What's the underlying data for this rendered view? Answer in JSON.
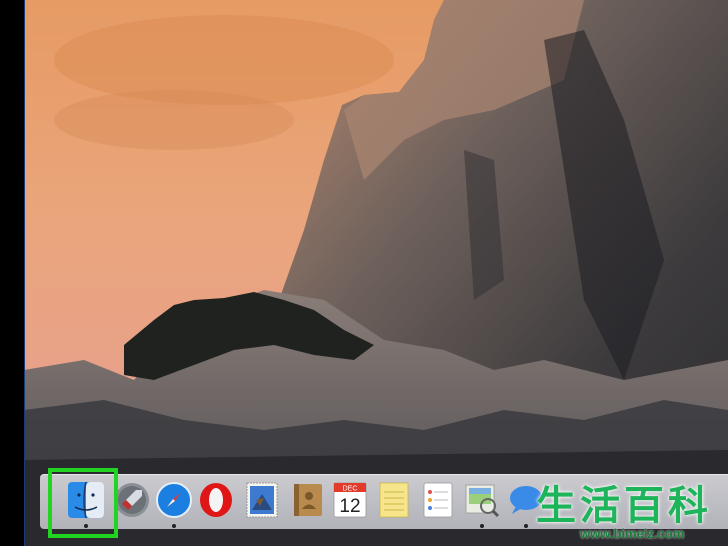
{
  "desktop": {
    "wallpaper_name": "Yosemite",
    "edge_color": "#1a3a7a"
  },
  "dock": {
    "items": [
      {
        "name": "Finder",
        "icon": "finder-icon",
        "running": true
      },
      {
        "name": "Launchpad",
        "icon": "rocket-icon",
        "running": false
      },
      {
        "name": "Safari",
        "icon": "compass-icon",
        "running": true
      },
      {
        "name": "Opera",
        "icon": "opera-icon",
        "running": false
      },
      {
        "name": "Mail",
        "icon": "stamp-icon",
        "running": false
      },
      {
        "name": "Contacts",
        "icon": "address-book-icon",
        "running": false
      },
      {
        "name": "Calendar",
        "icon": "calendar-icon",
        "running": false,
        "month": "DEC",
        "day": "12"
      },
      {
        "name": "Notes",
        "icon": "notes-icon",
        "running": false
      },
      {
        "name": "Reminders",
        "icon": "reminders-icon",
        "running": false
      },
      {
        "name": "Preview",
        "icon": "preview-icon",
        "running": true
      },
      {
        "name": "Messages",
        "icon": "messages-icon",
        "running": true
      }
    ],
    "highlight_color": "#22d422"
  },
  "watermark": {
    "text": "生活百科",
    "url": "www.bimeiz.com"
  }
}
